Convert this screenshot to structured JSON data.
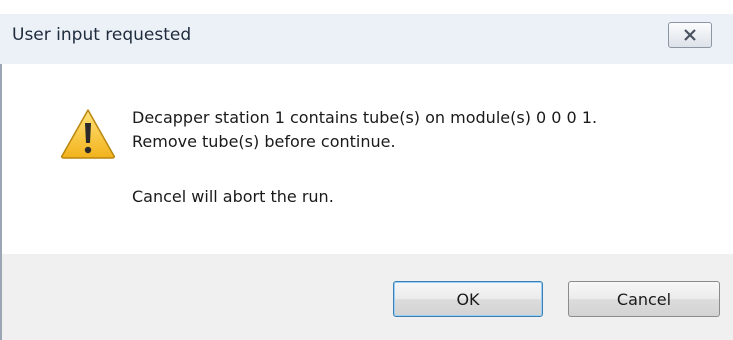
{
  "dialog": {
    "title": "User input requested",
    "close_icon": "close-icon",
    "warning_icon": "warning-icon",
    "message": {
      "line1": "Decapper station 1 contains tube(s) on module(s) 0 0 0 1.",
      "line2": "Remove tube(s) before continue.",
      "line3": "Cancel will abort the run."
    },
    "buttons": {
      "ok_label": "OK",
      "cancel_label": "Cancel"
    }
  }
}
